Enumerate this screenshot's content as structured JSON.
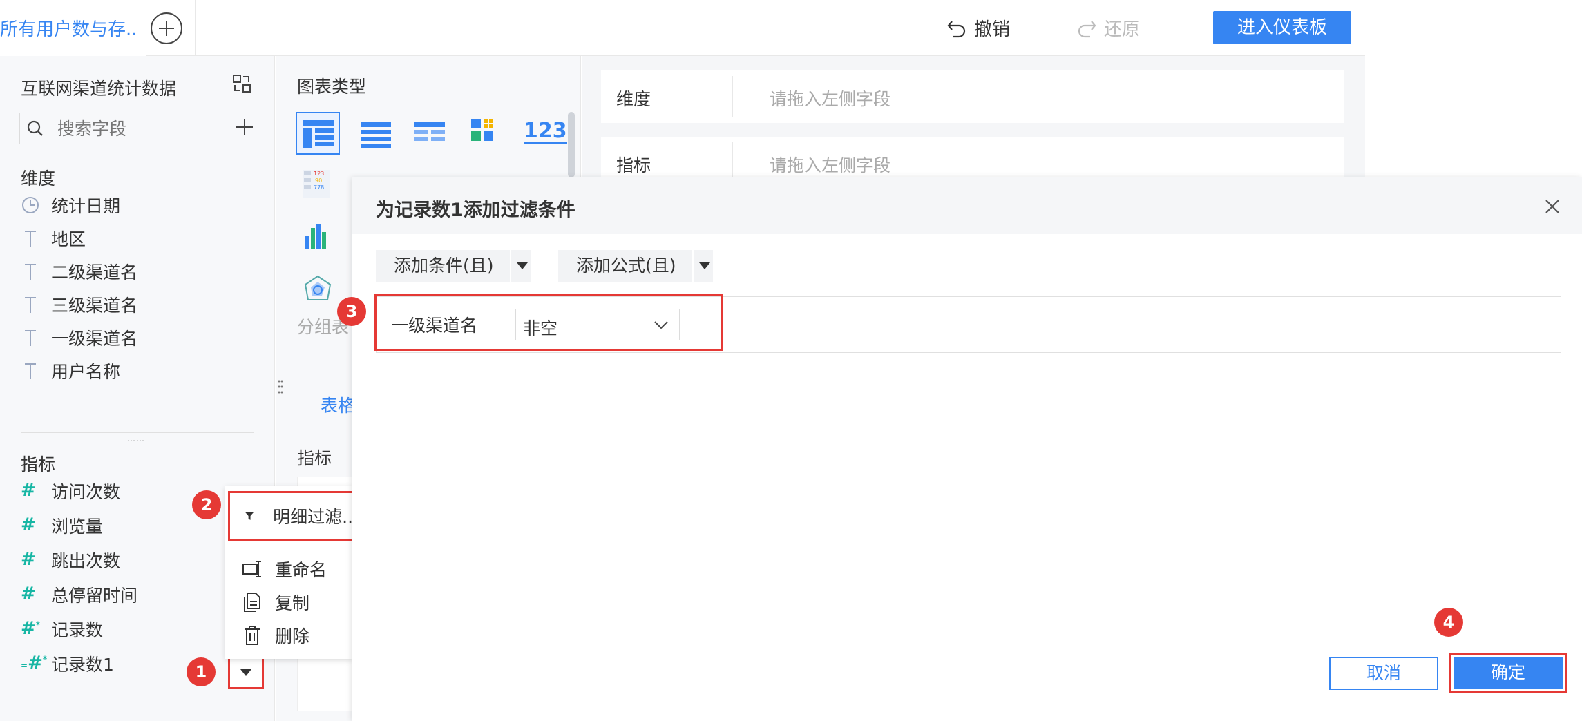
{
  "topbar": {
    "active_tab": "所有用户数与存...",
    "undo_label": "撤销",
    "redo_label": "还原",
    "enter_dashboard": "进入仪表板"
  },
  "left_panel": {
    "dataset_title": "互联网渠道统计数据",
    "search_placeholder": "搜索字段",
    "dimension_title": "维度",
    "dimensions": [
      {
        "label": "统计日期",
        "icon": "clock-icon"
      },
      {
        "label": "地区",
        "icon": "text-type-icon"
      },
      {
        "label": "二级渠道名",
        "icon": "text-type-icon"
      },
      {
        "label": "三级渠道名",
        "icon": "text-type-icon"
      },
      {
        "label": "一级渠道名",
        "icon": "text-type-icon"
      },
      {
        "label": "用户名称",
        "icon": "text-type-icon"
      }
    ],
    "measure_title": "指标",
    "measures": [
      {
        "label": "访问次数",
        "icon": "number-type-icon"
      },
      {
        "label": "浏览量",
        "icon": "number-type-icon"
      },
      {
        "label": "跳出次数",
        "icon": "number-type-icon"
      },
      {
        "label": "总停留时间",
        "icon": "number-type-icon"
      },
      {
        "label": "记录数",
        "icon": "number-record-icon"
      },
      {
        "label": "记录数1",
        "icon": "number-computed-icon"
      }
    ]
  },
  "context_menu": {
    "filter": "明细过滤...",
    "rename": "重命名",
    "copy": "复制",
    "delete": "删除"
  },
  "middle_panel": {
    "chart_type_title": "图表类型",
    "group_table_label": "分组表",
    "table_tab": "表格",
    "indicator_label": "指标",
    "number_tile": "123"
  },
  "shelves": {
    "dimension_label": "维度",
    "dimension_placeholder": "请拖入左侧字段",
    "indicator_label": "指标",
    "indicator_placeholder": "请拖入左侧字段"
  },
  "dialog": {
    "title": "为记录数1添加过滤条件",
    "add_condition": "添加条件(且)",
    "add_formula": "添加公式(且)",
    "condition_field": "一级渠道名",
    "condition_operator": "非空",
    "cancel": "取消",
    "confirm": "确定"
  },
  "steps": [
    "1",
    "2",
    "3",
    "4"
  ],
  "colors": {
    "accent": "#3685f2",
    "highlight": "#e53935",
    "number_icon": "#17b6a4"
  }
}
